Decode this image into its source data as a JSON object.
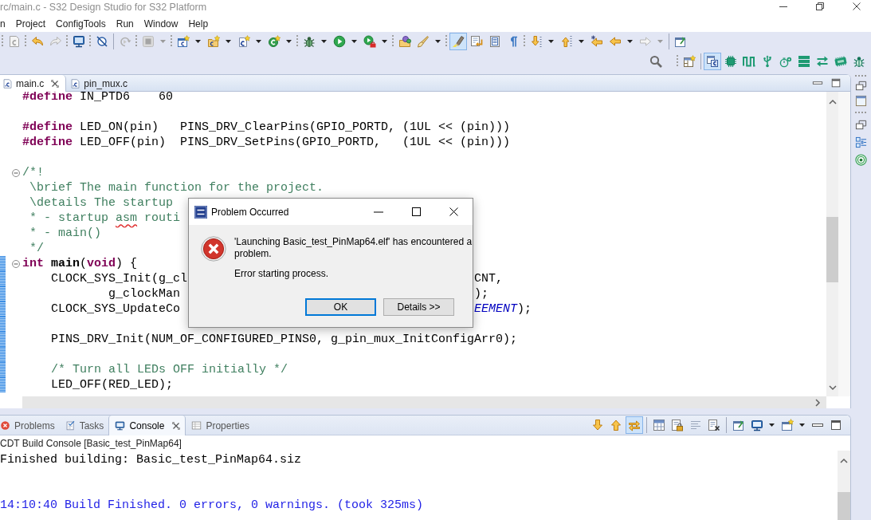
{
  "window": {
    "title": "rc/main.c - S32 Design Studio for S32 Platform"
  },
  "menu": [
    "n",
    "Project",
    "ConfigTools",
    "Run",
    "Window",
    "Help"
  ],
  "toolbar": {
    "editor_toggles": [
      {
        "on": true
      },
      {
        "on": false
      },
      {
        "on": false
      },
      {
        "on": false
      }
    ]
  },
  "perspectives": [
    {
      "selected": true
    },
    {
      "selected": false
    },
    {
      "selected": false
    },
    {
      "selected": false
    },
    {
      "selected": false
    },
    {
      "selected": false
    },
    {
      "selected": false
    },
    {
      "selected": false
    },
    {
      "selected": false
    }
  ],
  "editor": {
    "tabs": [
      {
        "label": "main.c",
        "selected": true
      },
      {
        "label": "pin_mux.c",
        "selected": false
      }
    ],
    "lines": [
      {
        "kind": "code",
        "changed": false,
        "tokens": [
          {
            "kind": "keyword",
            "text": "#define"
          },
          {
            "kind": "plain",
            "text": " IN_PTD6    60"
          }
        ]
      },
      {
        "kind": "blank",
        "changed": false
      },
      {
        "kind": "code",
        "changed": false,
        "tokens": [
          {
            "kind": "keyword",
            "text": "#define"
          },
          {
            "kind": "plain",
            "text": " LED_ON(pin)   PINS_DRV_ClearPins(GPIO_PORTD, (1UL << (pin)))"
          }
        ]
      },
      {
        "kind": "code",
        "changed": false,
        "tokens": [
          {
            "kind": "keyword",
            "text": "#define"
          },
          {
            "kind": "plain",
            "text": " LED_OFF(pin)  PINS_DRV_SetPins(GPIO_PORTD,   (1UL << (pin)))"
          }
        ]
      },
      {
        "kind": "blank",
        "changed": false
      },
      {
        "kind": "code",
        "changed": false,
        "fold": {
          "expanded": true
        },
        "tokens": [
          {
            "kind": "comment",
            "text": "/*!"
          }
        ]
      },
      {
        "kind": "code",
        "changed": false,
        "tokens": [
          {
            "kind": "comment",
            "text": " \\brief The main function for the project."
          }
        ]
      },
      {
        "kind": "code",
        "changed": false,
        "tokens": [
          {
            "kind": "comment",
            "text": " \\details The startup"
          }
        ]
      },
      {
        "kind": "code",
        "changed": false,
        "tokens": [
          {
            "kind": "comment",
            "text": " * - startup "
          },
          {
            "kind": "misspelled",
            "text": "asm"
          },
          {
            "kind": "comment",
            "text": " routi"
          }
        ]
      },
      {
        "kind": "code",
        "changed": false,
        "tokens": [
          {
            "kind": "comment",
            "text": " * - main()"
          }
        ]
      },
      {
        "kind": "code",
        "changed": false,
        "tokens": [
          {
            "kind": "comment",
            "text": " */"
          }
        ]
      },
      {
        "kind": "code",
        "changed": true,
        "fold": {
          "expanded": true
        },
        "tokens": [
          {
            "kind": "keyword",
            "text": "int"
          },
          {
            "kind": "function",
            "text": " main"
          },
          {
            "kind": "plain",
            "text": "("
          },
          {
            "kind": "keyword",
            "text": "void"
          },
          {
            "kind": "plain",
            "text": ") {"
          }
        ]
      },
      {
        "kind": "code",
        "changed": true,
        "tokens": [
          {
            "kind": "plain",
            "text": "    CLOCK_SYS_Init(g_cl"
          }
        ],
        "tail": [
          {
            "kind": "plain",
            "text": "CNT,"
          }
        ]
      },
      {
        "kind": "code",
        "changed": true,
        "tokens": [
          {
            "kind": "plain",
            "text": "            g_clockMan"
          }
        ],
        "tail": [
          {
            "kind": "plain",
            "text": ");"
          }
        ]
      },
      {
        "kind": "code",
        "changed": true,
        "tokens": [
          {
            "kind": "plain",
            "text": "    CLOCK_SYS_UpdateCo"
          }
        ],
        "tail": [
          {
            "kind": "constant",
            "text": "EEMENT"
          },
          {
            "kind": "plain",
            "text": ");"
          }
        ]
      },
      {
        "kind": "blank",
        "changed": true
      },
      {
        "kind": "code",
        "changed": true,
        "tokens": [
          {
            "kind": "plain",
            "text": "    PINS_DRV_Init(NUM_OF_CONFIGURED_PINS0, g_pin_mux_InitConfigArr0);"
          }
        ]
      },
      {
        "kind": "blank",
        "changed": true
      },
      {
        "kind": "code",
        "changed": true,
        "tokens": [
          {
            "kind": "comment",
            "text": "    /* Turn all LEDs OFF initially */"
          }
        ]
      },
      {
        "kind": "code",
        "changed": true,
        "tokens": [
          {
            "kind": "plain",
            "text": "    LED_OFF(RED_LED);"
          }
        ]
      }
    ]
  },
  "dialog": {
    "title": "Problem Occurred",
    "message": "'Launching Basic_test_PinMap64.elf' has encountered a problem.",
    "detail": "Error starting process.",
    "buttons": [
      {
        "label": "OK",
        "default": true
      },
      {
        "label": "Details >>",
        "default": false
      }
    ]
  },
  "bottom_panel": {
    "tabs": [
      {
        "label": "Problems",
        "selected": false
      },
      {
        "label": "Tasks",
        "selected": false
      },
      {
        "label": "Console",
        "selected": true
      },
      {
        "label": "Properties",
        "selected": false
      }
    ],
    "toolbar_toggles": [
      {
        "on": true
      },
      {
        "on": false
      },
      {
        "on": false
      }
    ],
    "console": {
      "title": "CDT Build Console [Basic_test_PinMap64]",
      "lines": [
        {
          "kind": "output",
          "text": "Finished building: Basic_test_PinMap64.siz"
        },
        {
          "kind": "blank"
        },
        {
          "kind": "blank"
        },
        {
          "kind": "status",
          "text": "14:10:40 Build Finished. 0 errors, 0 warnings. (took 325ms)"
        }
      ]
    }
  }
}
